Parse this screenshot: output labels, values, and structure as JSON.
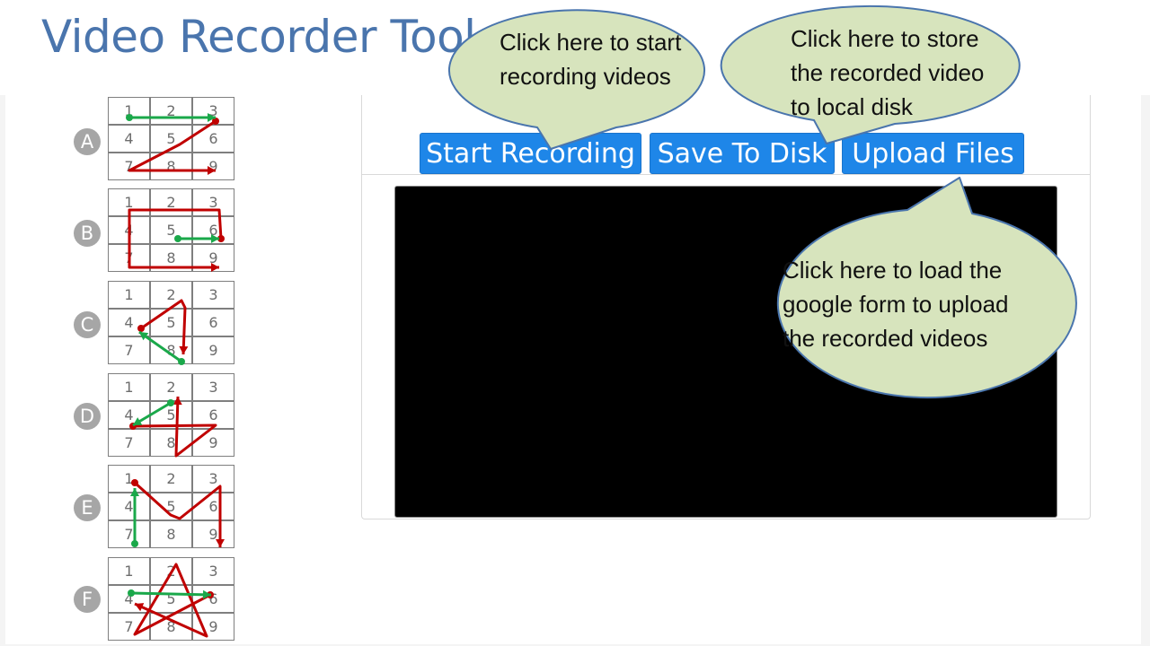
{
  "page": {
    "title": "Video Recorder Tool"
  },
  "toolbar": {
    "start_label": "Start Recording",
    "save_label": "Save To Disk",
    "upload_label": "Upload Files"
  },
  "callouts": {
    "start": {
      "lines": [
        "Click here to start",
        "recording videos"
      ]
    },
    "save": {
      "lines": [
        "Click here to store",
        "the recorded video",
        "to local disk"
      ]
    },
    "upload": {
      "lines": [
        "Click here to load the",
        "google form to upload",
        "the recorded videos"
      ]
    }
  },
  "patterns": [
    {
      "letter": "A",
      "cells": [
        "1",
        "2",
        "3",
        "4",
        "5",
        "6",
        "7",
        "8",
        "9"
      ]
    },
    {
      "letter": "B",
      "cells": [
        "1",
        "2",
        "3",
        "4",
        "5",
        "6",
        "7",
        "8",
        "9"
      ]
    },
    {
      "letter": "C",
      "cells": [
        "1",
        "2",
        "3",
        "4",
        "5",
        "6",
        "7",
        "8",
        "9"
      ]
    },
    {
      "letter": "D",
      "cells": [
        "1",
        "2",
        "3",
        "4",
        "5",
        "6",
        "7",
        "8",
        "9"
      ]
    },
    {
      "letter": "E",
      "cells": [
        "1",
        "2",
        "3",
        "4",
        "5",
        "6",
        "7",
        "8",
        "9"
      ]
    },
    {
      "letter": "F",
      "cells": [
        "1",
        "2",
        "3",
        "4",
        "5",
        "6",
        "7",
        "8",
        "9"
      ]
    }
  ],
  "colors": {
    "title": "#4a75ad",
    "button": "#1e86e8",
    "callout_fill": "#d7e4bd",
    "callout_stroke": "#4a75ad",
    "path_start": "#1aa84a",
    "path_main": "#c00000"
  }
}
